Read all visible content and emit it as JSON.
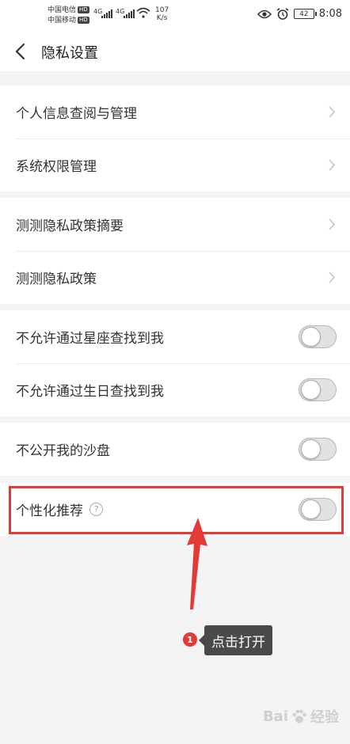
{
  "status_bar": {
    "carrier1": "中国电信",
    "carrier2": "中国移动",
    "hd_label": "HD",
    "network1": "4G",
    "network2": "4G",
    "net_speed_value": "107",
    "net_speed_unit": "K/s",
    "battery": "42",
    "time": "8:08"
  },
  "header": {
    "title": "隐私设置"
  },
  "groups": [
    {
      "items": [
        {
          "label": "个人信息查阅与管理"
        },
        {
          "label": "系统权限管理"
        }
      ]
    },
    {
      "items": [
        {
          "label": "测测隐私政策摘要"
        },
        {
          "label": "测测隐私政策"
        }
      ]
    },
    {
      "items": [
        {
          "label": "不允许通过星座查找到我",
          "on": false
        },
        {
          "label": "不允许通过生日查找到我",
          "on": false
        }
      ]
    },
    {
      "items": [
        {
          "label": "不公开我的沙盘",
          "on": false
        }
      ]
    },
    {
      "items": [
        {
          "label": "个性化推荐",
          "on": false,
          "help_glyph": "?"
        }
      ]
    }
  ],
  "annotation": {
    "step_number": "1",
    "tip_text": "点击打开",
    "highlight_color": "#e53935"
  },
  "watermark": {
    "text": "Bai",
    "text2": "经验"
  },
  "colors": {
    "background": "#f4f4f4",
    "toggle_off": "#e2e2e2"
  }
}
